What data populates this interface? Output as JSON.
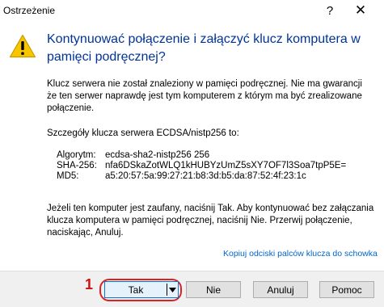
{
  "window": {
    "title": "Ostrzeżenie",
    "help_glyph": "?",
    "close_glyph": "✕"
  },
  "icon": "warning-icon",
  "heading": "Kontynuować połączenie i załączyć klucz komputera w pamięci podręcznej?",
  "paragraph1": "Klucz serwera nie został znaleziony w pamięci podręcznej. Nie ma gwarancji że ten serwer naprawdę jest tym komputerem z którym ma być zrealizowane połączenie.",
  "paragraph2": "Szczegóły klucza serwera ECDSA/nistp256 to:",
  "key_details": [
    {
      "key": "Algorytm:",
      "value": "ecdsa-sha2-nistp256 256"
    },
    {
      "key": "SHA-256:",
      "value": "nfa6DSkaZotWLQ1kHUBYzUmZ5sXY7OF7l3Soa7tpP5E="
    },
    {
      "key": "MD5:",
      "value": "a5:20:57:5a:99:27:21:b8:3d:b5:da:87:52:4f:23:1c"
    }
  ],
  "paragraph3": "Jeżeli ten komputer jest zaufany, naciśnij Tak. Aby kontynuować bez załączania klucza komputera w pamięci podręcznej, naciśnij Nie. Przerwij połączenie, naciskając, Anuluj.",
  "copy_link": "Kopiuj odciski palców klucza do schowka",
  "annotation_number": "1",
  "buttons": {
    "tak": "Tak",
    "nie": "Nie",
    "anuluj": "Anuluj",
    "pomoc": "Pomoc"
  },
  "colors": {
    "heading": "#003399",
    "link": "#0066cc",
    "annotation": "#d01010",
    "default_button_border": "#0078d7"
  }
}
